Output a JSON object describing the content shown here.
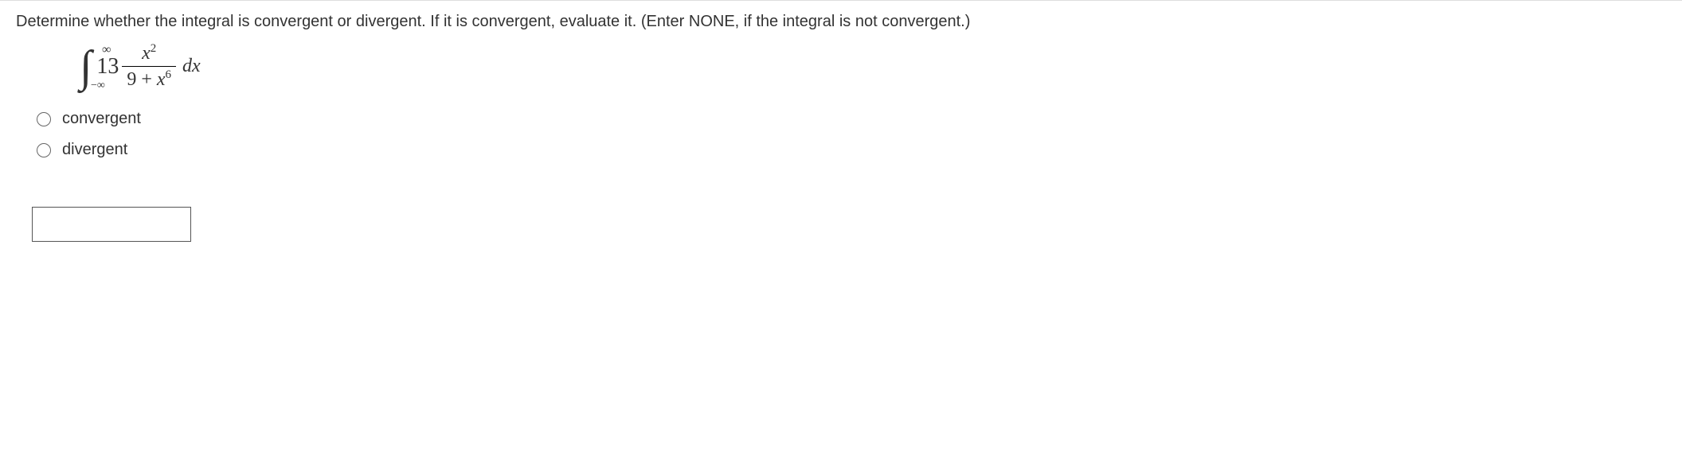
{
  "question": {
    "prompt": "Determine whether the integral is convergent or divergent. If it is convergent, evaluate it. (Enter NONE, if the integral is not convergent.)"
  },
  "integral": {
    "upper": "∞",
    "lower": "−∞",
    "coefficient": "13",
    "numerator_base": "x",
    "numerator_exp": "2",
    "denom_const": "9",
    "denom_op": "+",
    "denom_base": "x",
    "denom_exp": "6",
    "differential": "dx"
  },
  "options": {
    "opt1": "convergent",
    "opt2": "divergent"
  },
  "answer": {
    "value": ""
  }
}
